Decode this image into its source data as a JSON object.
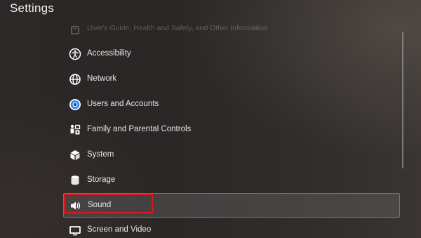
{
  "header": {
    "title": "Settings"
  },
  "menu": {
    "items": [
      {
        "label": "User's Guide, Health and Safety, and Other Information",
        "icon": "book-icon"
      },
      {
        "label": "Accessibility",
        "icon": "accessibility-icon"
      },
      {
        "label": "Network",
        "icon": "globe-icon"
      },
      {
        "label": "Users and Accounts",
        "icon": "account-circle-icon"
      },
      {
        "label": "Family and Parental Controls",
        "icon": "family-controls-icon"
      },
      {
        "label": "System",
        "icon": "cube-icon"
      },
      {
        "label": "Storage",
        "icon": "database-icon"
      },
      {
        "label": "Sound",
        "icon": "speaker-icon"
      },
      {
        "label": "Screen and Video",
        "icon": "monitor-icon"
      }
    ],
    "selected": "Sound"
  },
  "colors": {
    "highlight": "#e0141c",
    "accent_blue": "#2f8cf0"
  }
}
